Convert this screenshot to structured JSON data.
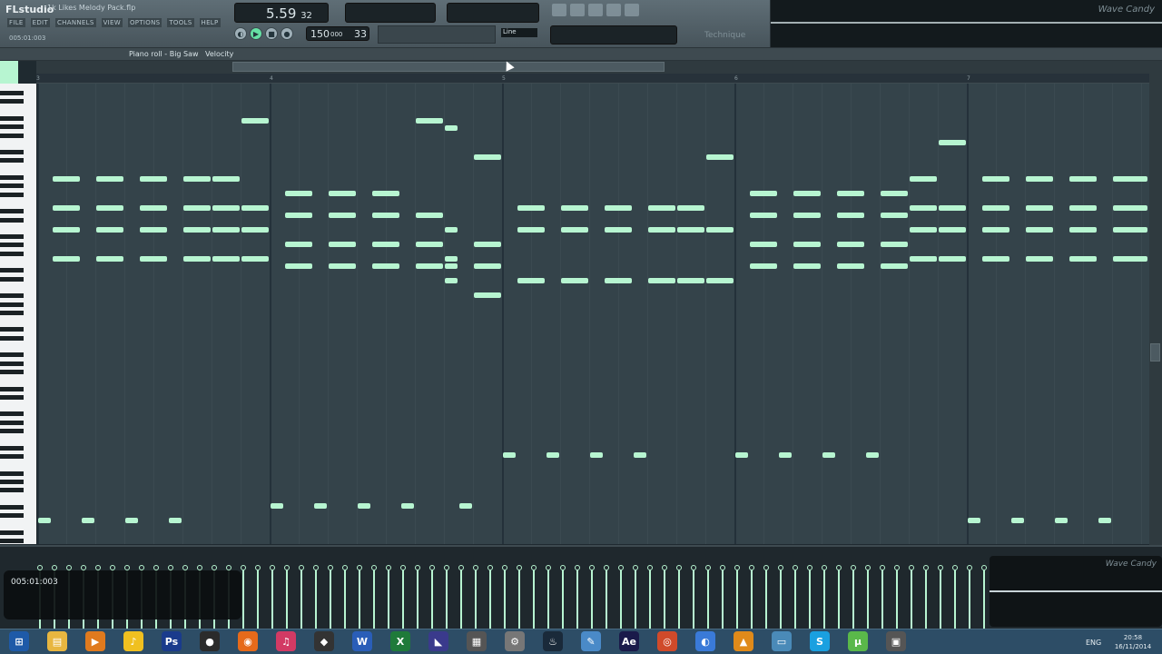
{
  "app": {
    "logo": "FLstudio",
    "project_title": "1k Likes Melody Pack.flp",
    "menu": [
      "FILE",
      "EDIT",
      "CHANNELS",
      "VIEW",
      "OPTIONS",
      "TOOLS",
      "HELP"
    ],
    "song_position_small": "005:01:003"
  },
  "transport": {
    "time_main": "5.59",
    "time_sub": "32",
    "tempo": "150",
    "tempo_fraction": "000",
    "pattern": "33",
    "snap": "Line",
    "technique_label": "Technique"
  },
  "visualizer": {
    "top_label": "Wave Candy",
    "bottom_label": "Wave Candy"
  },
  "piano_roll": {
    "title": "Piano roll - Big Saw",
    "target": "Velocity",
    "ruler_marks": [
      "3",
      "4",
      "5",
      "6",
      "7"
    ]
  },
  "hint_panel": {
    "time": "005:01:003"
  },
  "taskbar": {
    "icons": [
      "start-icon",
      "explorer-icon",
      "media-player-icon",
      "fl-studio-icon",
      "photoshop-icon",
      "camera-icon",
      "firefox-icon",
      "itunes-icon",
      "unity-icon",
      "word-icon",
      "excel-icon",
      "visual-studio-icon",
      "game-controller-icon",
      "settings-icon",
      "steam-icon",
      "pen-icon",
      "after-effects-icon",
      "chrome-icon",
      "compass-icon",
      "vlc-icon",
      "monitor-icon",
      "skype-icon",
      "utorrent-icon",
      "toolbox-icon"
    ],
    "lang": "ENG",
    "time": "20:58",
    "date": "16/11/2014"
  },
  "colors": {
    "note": "#b7f5d1",
    "grid_bg": "#34434a",
    "taskbar": "#2d4d66"
  }
}
